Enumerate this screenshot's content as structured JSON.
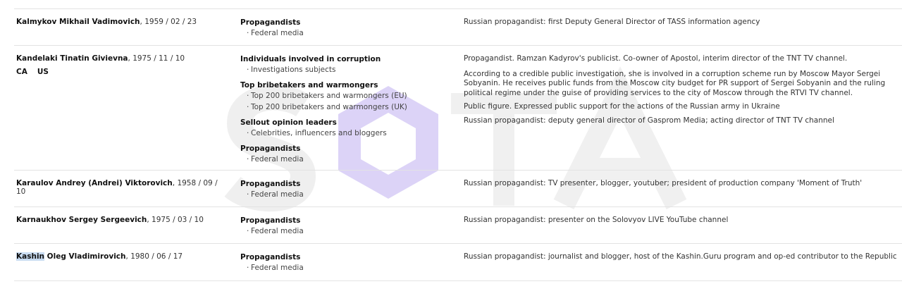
{
  "rows": [
    {
      "name": "Kalmykov Mikhail Vadimovich",
      "dob": ", 1959 / 02 / 23",
      "categories": [
        {
          "title": "Propagandists",
          "subs": [
            "Federal media"
          ]
        }
      ],
      "descriptions": [
        "Russian propagandist: first Deputy General Director of TASS information agency"
      ]
    },
    {
      "name": "Kandelaki Tinatin Givievna",
      "dob": ", 1975 / 11 / 10",
      "countries": [
        "CA",
        "US"
      ],
      "categories": [
        {
          "title": "Individuals involved in corruption",
          "subs": [
            "Investigations subjects"
          ]
        },
        {
          "title": "Top bribetakers and warmongers",
          "subs": [
            "Top 200 bribetakers and warmongers (EU)",
            "Top 200 bribetakers and warmongers (UK)"
          ]
        },
        {
          "title": "Sellout opinion leaders",
          "subs": [
            "Celebrities, influencers and bloggers"
          ]
        },
        {
          "title": "Propagandists",
          "subs": [
            "Federal media"
          ]
        }
      ],
      "descriptions": [
        "Propagandist. Ramzan Kadyrov's publicist. Co-owner of Apostol, interim director of the TNT TV channel.",
        "According to a credible public investigation, she is involved in a corruption scheme run by Moscow Mayor Sergei Sobyanin. He receives public funds from the Moscow city budget for PR support of Sergei Sobyanin and the ruling political regime under the guise of providing services to the city of Moscow through the RTVI TV channel.",
        "Public figure. Expressed public support for the actions of the Russian army in Ukraine",
        "Russian propagandist: deputy general director of Gasprom Media; acting director of TNT TV channel"
      ]
    },
    {
      "name": "Karaulov Andrey (Andrei) Viktorovich",
      "dob": ", 1958 / 09 / 10",
      "categories": [
        {
          "title": "Propagandists",
          "subs": [
            "Federal media"
          ]
        }
      ],
      "descriptions": [
        "Russian propagandist: TV presenter, blogger, youtuber; president of production company 'Moment of Truth'"
      ]
    },
    {
      "name": "Karnaukhov Sergey Sergeevich",
      "dob": ", 1975 / 03 / 10",
      "categories": [
        {
          "title": "Propagandists",
          "subs": [
            "Federal media"
          ]
        }
      ],
      "descriptions": [
        "Russian propagandist: presenter on the Solovyov LIVE YouTube channel"
      ]
    },
    {
      "name_highlight": "Kashin",
      "name_rest": " Oleg Vladimirovich",
      "dob": ", 1980 / 06 / 17",
      "categories": [
        {
          "title": "Propagandists",
          "subs": [
            "Federal media"
          ]
        }
      ],
      "descriptions": [
        "Russian propagandist: journalist and blogger, host of the Kashin.Guru program and op-ed contributor to the Republic"
      ]
    }
  ],
  "watermark": {
    "color": "#d9d0f5",
    "letters_color": "#ececec"
  }
}
